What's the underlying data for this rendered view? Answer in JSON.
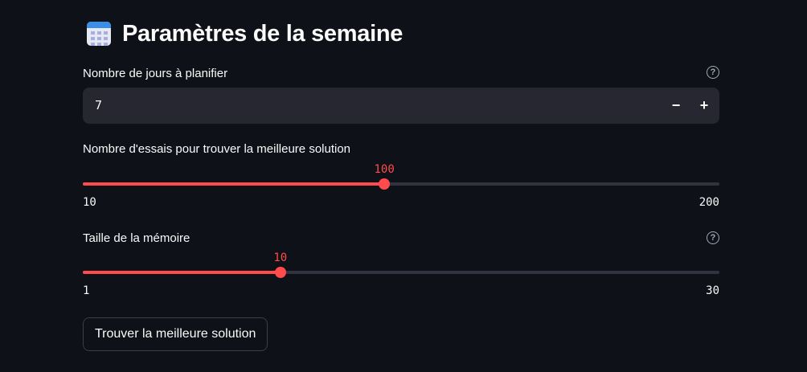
{
  "header": {
    "title": "Paramètres de la semaine",
    "icon": "calendar-icon"
  },
  "days_input": {
    "label": "Nombre de jours à planifier",
    "value": "7",
    "decrement_label": "−",
    "increment_label": "+",
    "help_glyph": "?"
  },
  "trials_slider": {
    "label": "Nombre d'essais pour trouver la meilleure solution",
    "value": 100,
    "value_text": "100",
    "min": 10,
    "max": 200,
    "min_text": "10",
    "max_text": "200"
  },
  "memory_slider": {
    "label": "Taille de la mémoire",
    "value": 10,
    "value_text": "10",
    "min": 1,
    "max": 30,
    "min_text": "1",
    "max_text": "30",
    "help_glyph": "?"
  },
  "action": {
    "button_label": "Trouver la meilleure solution"
  },
  "colors": {
    "background": "#0e1117",
    "accent": "#ff4b4b",
    "input_bg": "#262730",
    "track": "#31333f",
    "text": "#fafafa"
  }
}
